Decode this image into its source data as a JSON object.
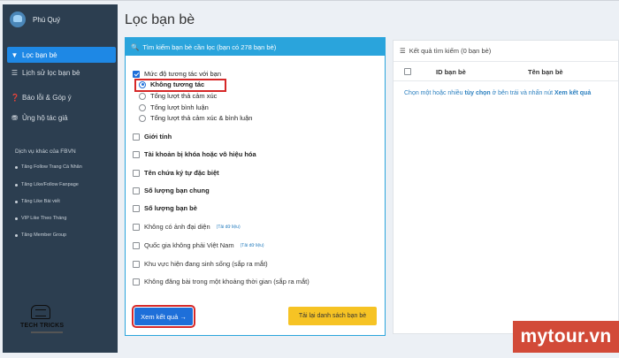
{
  "sidebar": {
    "user_name": "Phú Quý",
    "active_item": "Lọc bạn bè",
    "items": [
      {
        "label": "Lịch sử lọc bạn bè",
        "icon": "list-icon"
      },
      {
        "label": "Báo lỗi & Góp ý",
        "icon": "question-icon"
      },
      {
        "label": "Ủng hộ tác giả",
        "icon": "donate-icon"
      }
    ],
    "services_title": "Dịch vụ khác của FBVN",
    "services": [
      "Tăng Follow Trang Cá Nhân",
      "Tăng Like/Follow Fanpage",
      "Tăng Like Bài viết",
      "VIP Like Theo Tháng",
      "Tăng Member Group"
    ],
    "logo_text": "TECH TRICKS"
  },
  "page_title": "Lọc bạn bè",
  "filter_panel": {
    "header": "Tìm kiếm bạn bè cần lọc (bạn có 278 bạn bè)",
    "interaction_label": "Mức độ tương tác với bạn",
    "radios": [
      "Không tương tác",
      "Tổng lượt thả cảm xúc",
      "Tổng lượt bình luận",
      "Tổng lượt thả cảm xúc & bình luận"
    ],
    "options": [
      "Giới tính",
      "Tài khoản bị khóa hoặc vô hiệu hóa",
      "Tên chứa ký tự đặc biệt",
      "Số lượng bạn chung",
      "Số lượng bạn bè"
    ],
    "muted_options": [
      "Không có ảnh đại diện",
      "Quốc gia không phải Việt Nam",
      "Khu vực hiện đang sinh sống (sắp ra mắt)",
      "Không đăng bài trong một khoảng thời gian (sắp ra mắt)"
    ],
    "hint": "(Tải dữ liệu)",
    "submit_label": "Xem kết quả →",
    "reload_label": "Tải lại danh sách bạn bè"
  },
  "results_panel": {
    "header": "Kết quả tìm kiếm (0 bạn bè)",
    "col_id": "ID bạn bè",
    "col_name": "Tên bạn bè",
    "msg_a": "Chọn một hoặc nhiều ",
    "msg_b": "tùy chọn",
    "msg_c": " ở bên trái và nhấn nút ",
    "msg_d": "Xem kết quả"
  },
  "watermark": "mytour.vn",
  "colors": {
    "accent": "#1e88e5",
    "panel_header": "#2aa4dc",
    "sidebar": "#2c3e50",
    "highlight": "#d62828",
    "warn": "#f6c324"
  }
}
